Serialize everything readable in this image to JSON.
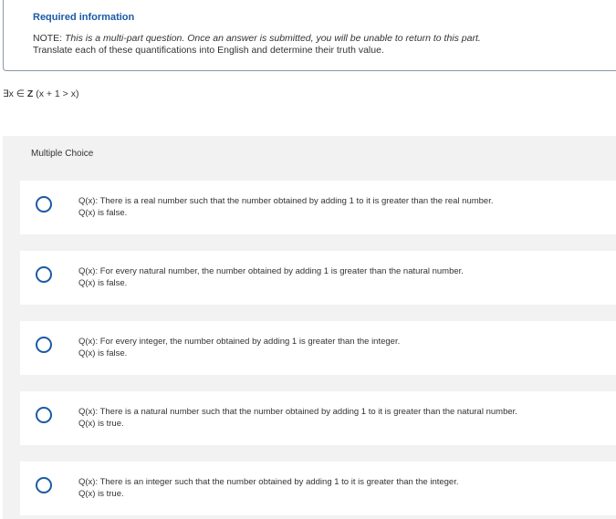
{
  "header": {
    "title": "Required information",
    "note_lead": "NOTE: ",
    "note_italic": "This is a multi-part question. Once an answer is submitted, you will be unable to return to this part.",
    "instruction": "Translate each of these quantifications into English and determine their truth value."
  },
  "expression": {
    "prefix": "∃x ∈ ",
    "set": "Z",
    "body": " (x + 1 > x)"
  },
  "question": {
    "type_label": "Multiple Choice",
    "options": [
      {
        "line1": "Q(x): There is a real number such that the number obtained by adding 1 to it is greater than the real number.",
        "line2": "Q(x) is false."
      },
      {
        "line1": "Q(x): For every natural number, the number obtained by adding 1 is greater than the natural number.",
        "line2": "Q(x) is false."
      },
      {
        "line1": "Q(x): For every integer, the number obtained by adding 1 is greater than the integer.",
        "line2": "Q(x) is false."
      },
      {
        "line1": "Q(x): There is a natural number such that the number obtained by adding 1 to it is greater than the natural number.",
        "line2": "Q(x) is true."
      },
      {
        "line1": "Q(x): There is an integer such that the number obtained by adding 1 to it is greater than the integer.",
        "line2": "Q(x) is true."
      }
    ]
  },
  "colors": {
    "accent": "#1a5aa6",
    "panel": "#f2f2f2"
  }
}
